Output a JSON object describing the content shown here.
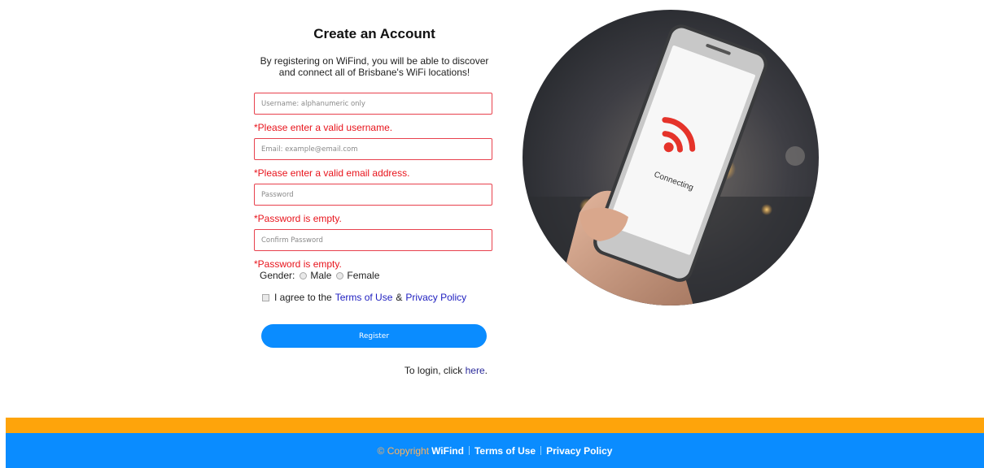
{
  "form": {
    "title": "Create an Account",
    "intro_line1": "By registering on WiFind, you will be able to discover",
    "intro_line2": "and connect all of Brisbane's WiFi locations!",
    "username_placeholder": "Username: alphanumeric only",
    "username_error": "*Please enter a valid username.",
    "email_placeholder": "Email: example@email.com",
    "email_error": "*Please enter a valid email address.",
    "password_placeholder": "Password",
    "password_error": "*Password is empty.",
    "confirm_placeholder": "Confirm Password",
    "confirm_error": "*Password is empty.",
    "gender_label": "Gender:",
    "gender_options": [
      "Male",
      "Female"
    ],
    "agree_prefix": "I agree to the",
    "terms_link": "Terms of Use",
    "agree_amp": "&",
    "privacy_link": "Privacy Policy",
    "register_label": "Register",
    "login_prefix": "To login, click",
    "login_link": "here",
    "login_suffix": "."
  },
  "hero": {
    "phone_screen_text": "Connecting",
    "icon": "wifi-icon"
  },
  "footer": {
    "copyright": "© Copyright",
    "brand": "WiFind",
    "terms": "Terms of Use",
    "privacy": "Privacy Policy"
  },
  "colors": {
    "accent_blue": "#0a8cff",
    "accent_orange": "#fea40b",
    "error_red": "#e8141c",
    "link_blue": "#2020c0"
  }
}
